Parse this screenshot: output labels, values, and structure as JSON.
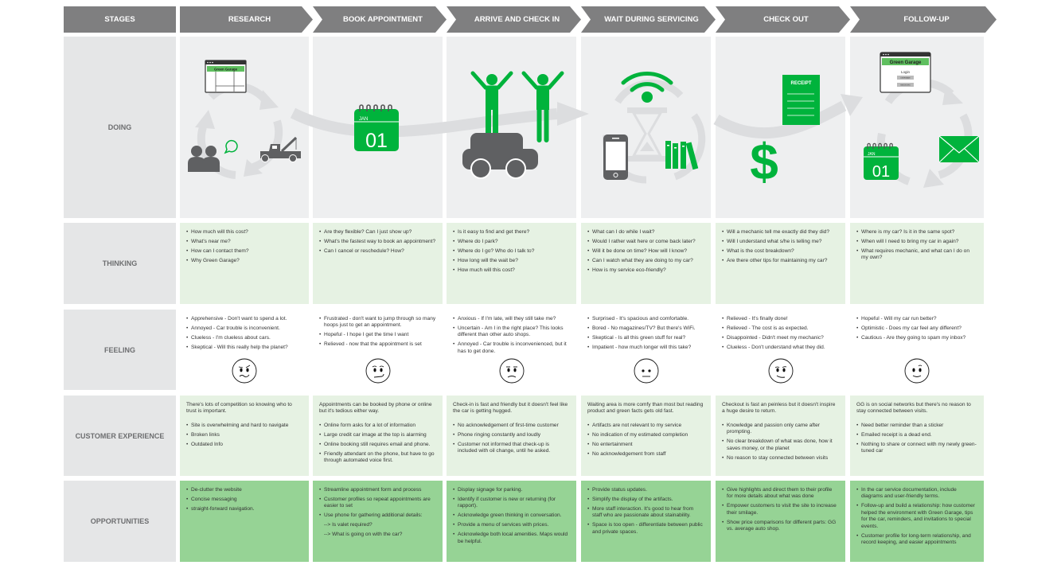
{
  "header": {
    "stages_label": "STAGES",
    "stages": [
      {
        "label": "RESEARCH"
      },
      {
        "label": "BOOK APPOINTMENT"
      },
      {
        "label": "ARRIVE AND CHECK IN"
      },
      {
        "label": "WAIT DURING SERVICING"
      },
      {
        "label": "CHECK OUT"
      },
      {
        "label": "FOLLOW-UP"
      }
    ]
  },
  "rows": {
    "doing": "DOING",
    "thinking": "THINKING",
    "feeling": "FEELING",
    "customer_experience": "CUSTOMER EXPERIENCE",
    "opportunities": "OPPORTUNITIES"
  },
  "colors": {
    "header_gray": "#7f7f80",
    "label_gray": "#e5e6e7",
    "doing_bg": "#eeeff0",
    "light_green": "#e6f2e3",
    "green": "#96d395",
    "brand_green": "#00b33c",
    "icon_gray": "#5f6062"
  },
  "doing": {
    "research": {
      "icons": [
        "website-icon",
        "people-chat-icon",
        "tow-truck-icon",
        "cycle-arrows-icon"
      ],
      "site_title": "Green Garage"
    },
    "book": {
      "icons": [
        "calendar-icon"
      ],
      "month": "JAN",
      "day": "01"
    },
    "arrive": {
      "icons": [
        "cheering-people-icon",
        "car-icon"
      ]
    },
    "wait": {
      "icons": [
        "wifi-icon",
        "hourglass-icon",
        "phone-icon",
        "books-icon"
      ]
    },
    "checkout": {
      "icons": [
        "receipt-icon",
        "dollar-icon"
      ],
      "receipt_label": "RECEIPT"
    },
    "followup": {
      "icons": [
        "login-site-icon",
        "calendar-icon",
        "mail-icon"
      ],
      "site_title": "Green Garage",
      "login_label": "Login",
      "username": "USERNAME",
      "password": "PASSWORD",
      "month": "JAN",
      "day": "01"
    }
  },
  "thinking": [
    [
      "How much will this cost?",
      "What's near me?",
      "How can I contact them?",
      "Why Green Garage?"
    ],
    [
      "Are they flexible? Can I just show up?",
      "What's the fastest way to book an appointment?",
      "Can I cancel or reschedule? How?"
    ],
    [
      "Is it easy to find and get there?",
      "Where do I park?",
      "Where do I go? Who do I talk to?",
      "How long will the wait be?",
      "How much will this cost?"
    ],
    [
      "What can I do while I wait?",
      "Would I rather wait here or come back later?",
      "Will it be done on time? How will I know?",
      "Can I watch what they are doing to my car?",
      "How is my service eco-friendly?"
    ],
    [
      "Will a mechanic tell me exactly did they did?",
      "Will I understand what s/he is telling me?",
      "What is the cost breakdown?",
      "Are there other tips for maintaining my car?"
    ],
    [
      "Where is my car? Is it in the same spot?",
      "When will I need to bring my car in again?",
      "What requires mechanic, and what can I do on my own?"
    ]
  ],
  "feeling": [
    {
      "items": [
        "Apprehensive - Don't want to spend a lot.",
        "Annoyed - Car trouble is inconvenient.",
        "Clueless - I'm clueless about cars.",
        "Skeptical - Will this really help the planet?"
      ],
      "face": "skeptical"
    },
    {
      "items": [
        "Frustrated - don't want to jump through so many hoops just to get an appointment.",
        "Hopeful - I hope I get the time I want",
        "Relieved - now that the appointment is set"
      ],
      "face": "unsure"
    },
    {
      "items": [
        "Anxious - If I'm late, will they still take me?",
        "Uncertain - Am I in the right place? This looks different than other auto shops.",
        "Annoyed - Car trouble is inconvenienced, but it has to get done."
      ],
      "face": "annoyed"
    },
    {
      "items": [
        "Surprised - It's spacious and comfortable.",
        "Bored - No magazines/TV? But there's WiFi.",
        "Skeptical - Is all this green stuff for real?",
        "Impatient - how much longer will this take?"
      ],
      "face": "neutral"
    },
    {
      "items": [
        "Relieved - It's finally done!",
        "Relieved - The cost is as expected.",
        "Disappointed - Didn't meet my mechanic?",
        "Clueless - Don't understand what they did."
      ],
      "face": "relieved"
    },
    {
      "items": [
        "Hopeful - Will my car run better?",
        "Optimistic - Does my car feel any different?",
        "Cautious - Are they going to spam my inbox?"
      ],
      "face": "hopeful"
    }
  ],
  "customer_experience": [
    {
      "intro": "There's lots of competition so knowing who to trust is important.",
      "items": [
        "Site is overwhelming and hard to navigate",
        "Broken links",
        "Outdated Info"
      ]
    },
    {
      "intro": "Appointments can be booked by phone or online but it's tedious either way.",
      "items": [
        "Online form asks for a lot of information",
        "Large credit car image at the top is alarming",
        "Online booking still requires email and phone.",
        "Friendly attendant on the phone, but have to go through automated voice first."
      ]
    },
    {
      "intro": "Check-in is fast and friendly but it doesn't feel like the car is getting hugged.",
      "items": [
        "No acknowledgement of first-time customer",
        "Phone ringing constantly and loudly",
        "Customer not informed that check-up is included with oil change, until he asked."
      ]
    },
    {
      "intro": "Waiting area is more comfy than most but reading product and green facts gets old fast.",
      "items": [
        "Artifacts are not relevant to my service",
        "No indication of my estimated completion",
        "No entertainment",
        "No acknowledgement from staff"
      ]
    },
    {
      "intro": "Checkout is fast an peinless but it doesn't inspire a huge desire to return.",
      "items": [
        "Knowledge and passion only came after prompting.",
        "No clear breakdown of what was done, how it saves money, or the planet",
        "No reason to stay connected between visits"
      ]
    },
    {
      "intro": "GG is on social networks but there's no reason to stay connected between visits.",
      "items": [
        "Need better reminder than a sticker",
        "Emailed receipt is a dead end.",
        "Nothing to share or connect with my newly green-tuned car"
      ]
    }
  ],
  "opportunities": [
    {
      "items": [
        "De-clutter the website",
        "Concise messaging",
        "straight-forward navigation."
      ],
      "sub": []
    },
    {
      "items": [
        "Streamline appointment form and process",
        "Customer profiles so repeat appointments are easier to set",
        "Use phone for gathering additional details:"
      ],
      "sub": [
        "--> Is valet required?",
        "--> What is going on with the car?"
      ]
    },
    {
      "items": [
        "Display signage for parking.",
        "Identify if customer is new or returning (for rapport).",
        "Acknowledge green thinking in conversation.",
        "Provide a menu of services with prices.",
        "Acknowledge both local amenities. Maps would be helpful."
      ],
      "sub": []
    },
    {
      "items": [
        "Provide status updates.",
        "Simplify the display of the artifacts.",
        "More staff interaction. It's good to hear from staff who are passionate about stainability.",
        "Space is too open - differentiate between public and private spaces."
      ],
      "sub": []
    },
    {
      "items": [
        "Give highlights and direct them to their profile for more details about what was done",
        "Empower customers to visit the site to increase their smilage.",
        "Show price comparisons for different parts: GG vs. average auto shop."
      ],
      "sub": []
    },
    {
      "items": [
        "In the car service documentation, include diagrams and user-friendly terms.",
        "Follow-up and build a relationship: how customer helped the environment with Green Garage, tips for the car, reminders, and invitations to special events.",
        "Customer profile for long-term relationship, and record keeping, and easier appointments"
      ],
      "sub": []
    }
  ]
}
